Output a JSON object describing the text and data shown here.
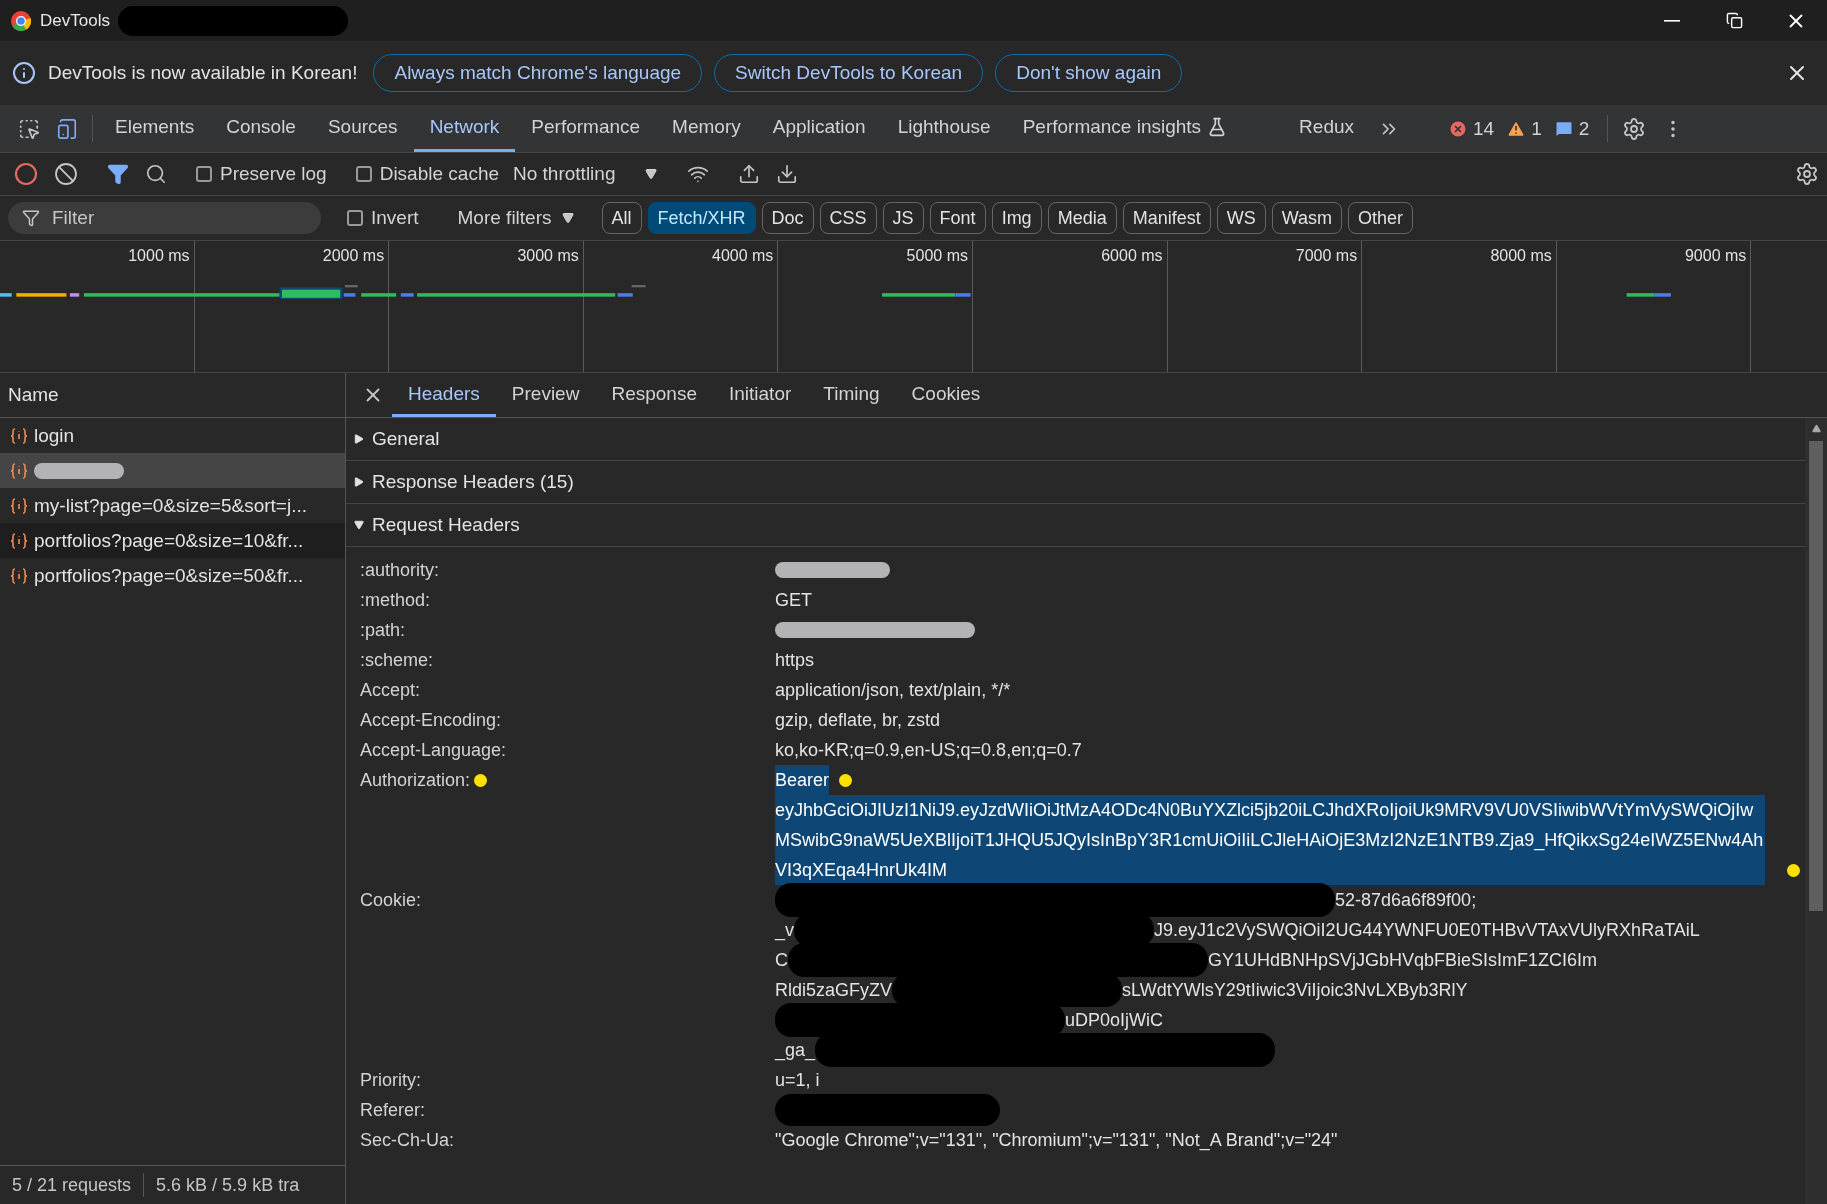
{
  "window": {
    "title": "DevTools"
  },
  "infobar": {
    "message": "DevTools is now available in Korean!",
    "buttons": [
      "Always match Chrome's language",
      "Switch DevTools to Korean",
      "Don't show again"
    ]
  },
  "panel_tabs": [
    {
      "label": "Elements",
      "selected": false
    },
    {
      "label": "Console",
      "selected": false
    },
    {
      "label": "Sources",
      "selected": false
    },
    {
      "label": "Network",
      "selected": true
    },
    {
      "label": "Performance",
      "selected": false
    },
    {
      "label": "Memory",
      "selected": false
    },
    {
      "label": "Application",
      "selected": false
    },
    {
      "label": "Lighthouse",
      "selected": false
    },
    {
      "label": "Performance insights",
      "selected": false,
      "experimental": true
    },
    {
      "label": "Redux",
      "selected": false
    }
  ],
  "counts": {
    "errors": "14",
    "warnings": "1",
    "messages": "2"
  },
  "toolbar": {
    "preserve_log": {
      "label": "Preserve log",
      "checked": false
    },
    "disable_cache": {
      "label": "Disable cache",
      "checked": false
    },
    "throttling": "No throttling"
  },
  "filter_bar": {
    "placeholder": "Filter",
    "invert": {
      "label": "Invert",
      "checked": false
    },
    "more_filters": "More filters",
    "types": [
      {
        "label": "All",
        "selected": false
      },
      {
        "label": "Fetch/XHR",
        "selected": true
      },
      {
        "label": "Doc",
        "selected": false
      },
      {
        "label": "CSS",
        "selected": false
      },
      {
        "label": "JS",
        "selected": false
      },
      {
        "label": "Font",
        "selected": false
      },
      {
        "label": "Img",
        "selected": false
      },
      {
        "label": "Media",
        "selected": false
      },
      {
        "label": "Manifest",
        "selected": false
      },
      {
        "label": "WS",
        "selected": false
      },
      {
        "label": "Wasm",
        "selected": false
      },
      {
        "label": "Other",
        "selected": false
      }
    ]
  },
  "timeline": {
    "ticks": [
      "1000 ms",
      "2000 ms",
      "3000 ms",
      "4000 ms",
      "5000 ms",
      "6000 ms",
      "7000 ms",
      "8000 ms",
      "9000 ms"
    ]
  },
  "requests": {
    "column": "Name",
    "items": [
      {
        "name": "login",
        "selected": false,
        "redacted": false
      },
      {
        "selected": true,
        "redacted": true
      },
      {
        "name": "my-list?page=0&size=5&sort=j...",
        "selected": false,
        "redacted": false
      },
      {
        "name": "portfolios?page=0&size=10&fr...",
        "selected": false,
        "hovered": true,
        "redacted": false
      },
      {
        "name": "portfolios?page=0&size=50&fr...",
        "selected": false,
        "redacted": false
      }
    ]
  },
  "details": {
    "tabs": [
      {
        "label": "Headers",
        "selected": true
      },
      {
        "label": "Preview",
        "selected": false
      },
      {
        "label": "Response",
        "selected": false
      },
      {
        "label": "Initiator",
        "selected": false
      },
      {
        "label": "Timing",
        "selected": false
      },
      {
        "label": "Cookies",
        "selected": false
      }
    ],
    "sections": [
      {
        "title": "General",
        "expanded": false
      },
      {
        "title": "Response Headers (15)",
        "expanded": false
      },
      {
        "title": "Request Headers",
        "expanded": true
      }
    ],
    "request_headers": [
      {
        "name": ":authority:",
        "kind": "blurred"
      },
      {
        "name": ":method:",
        "kind": "text",
        "value": "GET"
      },
      {
        "name": ":path:",
        "kind": "blurred"
      },
      {
        "name": ":scheme:",
        "kind": "text",
        "value": "https"
      },
      {
        "name": "Accept:",
        "kind": "text",
        "value": "application/json, text/plain, */*"
      },
      {
        "name": "Accept-Encoding:",
        "kind": "text",
        "value": "gzip, deflate, br, zstd"
      },
      {
        "name": "Accept-Language:",
        "kind": "text",
        "value": "ko,ko-KR;q=0.9,en-US;q=0.8,en;q=0.7"
      },
      {
        "name": "Authorization:",
        "kind": "token",
        "scheme": "Bearer",
        "value": "eyJhbGciOiJIUzI1NiJ9.eyJzdWIiOiJtMzA4ODc4N0BuYXZlci5jb20iLCJhdXRoIjoiUk9MRV9VU0VSIiwibWVtYmVySWQiOjIwMSwibG9naW5UeXBlIjoiT1JHQU5JQyIsInBpY3R1cmUiOiIiLCJleHAiOjE3MzI2NzE1NTB9.Zja9_HfQikxSg24eIWZ5ENw4AhVI3qXEqa4HnrUk4IM",
        "selected": true
      },
      {
        "name": "Cookie:",
        "kind": "cookie",
        "lines": [
          {
            "right": "52-87d6a6f89f00;"
          },
          {
            "left": "_v",
            "right": "J9.eyJ1c2VySWQiOiI2UG44YWNFU0E0THBvVTAxVUlyRXhRaTAiL"
          },
          {
            "left": "C",
            "right": "GY1UHdBNHpSVjJGbHVqbFBieSIsImF1ZCI6Im"
          },
          {
            "left": "Rldi5zaGFyZV",
            "right": "sLWdtYWlsY29tIiwic3ViIjoic3NvLXByb3RlY"
          },
          {
            "right": "uDP0oIjWiC"
          },
          {
            "left": "_ga_"
          }
        ]
      },
      {
        "name": "Priority:",
        "kind": "text",
        "value": "u=1, i"
      },
      {
        "name": "Referer:",
        "kind": "blacked"
      },
      {
        "name": "Sec-Ch-Ua:",
        "kind": "text",
        "value": "\"Google Chrome\";v=\"131\", \"Chromium\";v=\"131\", \"Not_A Brand\";v=\"24\""
      }
    ]
  },
  "status_bar": [
    "5 / 21 requests",
    "5.6 kB / 5.9 kB tra"
  ]
}
